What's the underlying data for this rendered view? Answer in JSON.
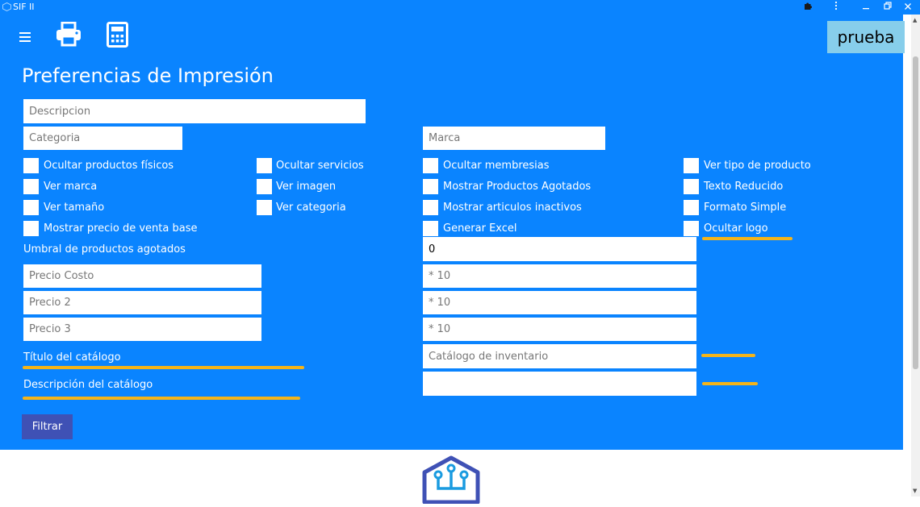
{
  "window": {
    "title": "SIF II",
    "extension_icon": "puzzle-icon",
    "menu_icon": "vertical-dots-icon",
    "minimize_icon": "minimize-icon",
    "restore_icon": "restore-icon",
    "close_icon": "close-icon"
  },
  "toolbar": {
    "menu_icon": "hamburger-icon",
    "print_icon": "printer-icon",
    "calculator_icon": "calculator-icon",
    "user_label": "prueba"
  },
  "page": {
    "title": "Preferencias de Impresión"
  },
  "fields": {
    "descripcion": {
      "placeholder": "Descripcion"
    },
    "categoria": {
      "placeholder": "Categoria"
    },
    "marca": {
      "placeholder": "Marca"
    }
  },
  "checkboxes": [
    {
      "label": "Ocultar productos físicos",
      "checked": false
    },
    {
      "label": "Ocultar servicios",
      "checked": false
    },
    {
      "label": "Ocultar membresias",
      "checked": false
    },
    {
      "label": "Ver tipo de producto",
      "checked": false
    },
    {
      "label": "Ver marca",
      "checked": false
    },
    {
      "label": "Ver imagen",
      "checked": false
    },
    {
      "label": "Mostrar Productos Agotados",
      "checked": false
    },
    {
      "label": "Texto Reducido",
      "checked": false
    },
    {
      "label": "Ver tamaño",
      "checked": false
    },
    {
      "label": "Ver categoria",
      "checked": false
    },
    {
      "label": "Mostrar articulos inactivos",
      "checked": false
    },
    {
      "label": "Formato Simple",
      "checked": false
    },
    {
      "label": "Mostrar precio de venta base",
      "checked": false
    },
    {
      "label": "Generar Excel",
      "checked": false
    },
    {
      "label": "Ocultar logo",
      "checked": false
    }
  ],
  "umbral": {
    "label": "Umbral de productos agotados",
    "value": "0"
  },
  "prices": {
    "costo": {
      "placeholder": "Precio Costo",
      "factor": "* 10"
    },
    "precio2": {
      "placeholder": "Precio 2",
      "factor": "* 10"
    },
    "precio3": {
      "placeholder": "Precio 3",
      "factor": "* 10"
    }
  },
  "catalog": {
    "title_label": "Título del catálogo",
    "title_value": "Catálogo de inventario",
    "description_label": "Descripción del catálogo",
    "description_value": ""
  },
  "actions": {
    "filter_label": "Filtrar"
  },
  "footer": {
    "logo_icon": "circuit-logo-icon"
  },
  "colors": {
    "background": "#0a84ff",
    "user_badge": "#87ceeb",
    "filter_button": "#3f51b5",
    "highlight": "#f4b41a"
  }
}
